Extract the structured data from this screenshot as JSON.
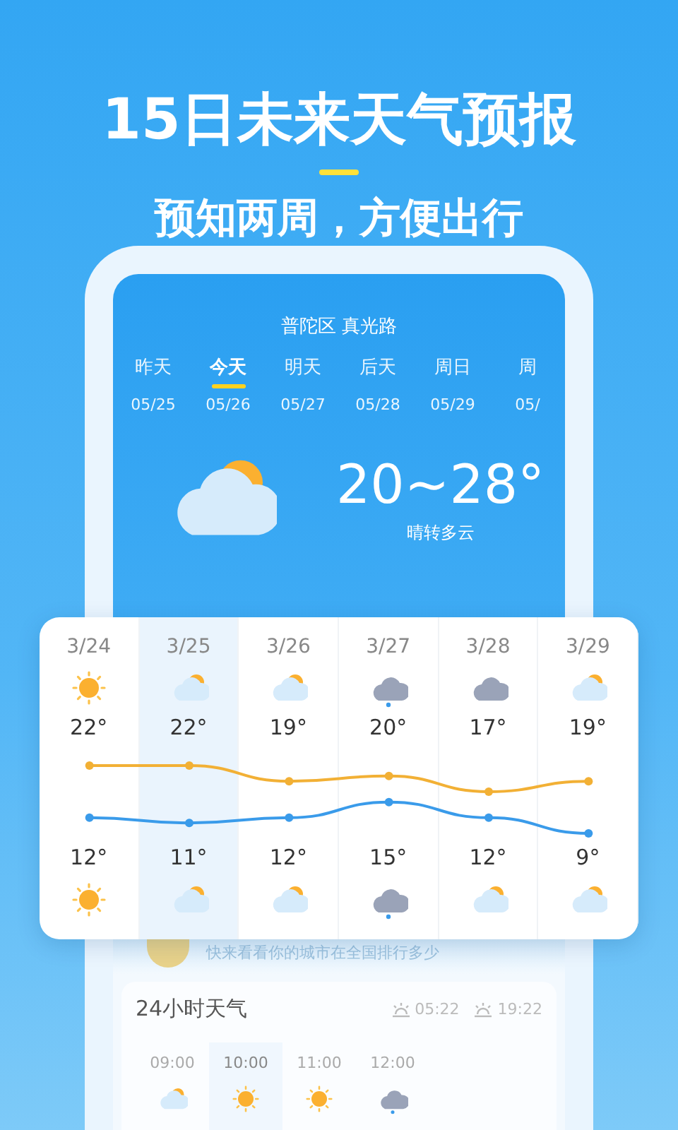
{
  "headline": "15日未来天气预报",
  "subheadline": "预知两周，方便出行",
  "phone": {
    "location": "普陀区 真光路",
    "day_tabs": [
      {
        "label": "昨天",
        "date": "05/25",
        "selected": false
      },
      {
        "label": "今天",
        "date": "05/26",
        "selected": true
      },
      {
        "label": "明天",
        "date": "05/27",
        "selected": false
      },
      {
        "label": "后天",
        "date": "05/28",
        "selected": false
      },
      {
        "label": "周日",
        "date": "05/29",
        "selected": false
      },
      {
        "label": "周",
        "date": "05/",
        "selected": false
      }
    ],
    "current": {
      "temperature": "20~28°",
      "condition": "晴转多云",
      "kind": "partly"
    },
    "ranking_text": "快来看看你的城市在全国排行多少",
    "hourly": {
      "title": "24小时天气",
      "sunrise": "05:22",
      "sunset": "19:22",
      "hours": [
        {
          "time": "09:00",
          "kind": "partly",
          "selected": false
        },
        {
          "time": "10:00",
          "kind": "sunny",
          "selected": true
        },
        {
          "time": "11:00",
          "kind": "sunny",
          "selected": false
        },
        {
          "time": "12:00",
          "kind": "rain",
          "selected": false
        }
      ]
    }
  },
  "forecast": {
    "days": [
      {
        "date": "3/24",
        "high": "22°",
        "low": "12°",
        "day_weather": {
          "kind": "sunny"
        },
        "night_weather": {
          "kind": "sunny"
        },
        "selected": false
      },
      {
        "date": "3/25",
        "high": "22°",
        "low": "11°",
        "day_weather": {
          "kind": "partly"
        },
        "night_weather": {
          "kind": "partly"
        },
        "selected": true
      },
      {
        "date": "3/26",
        "high": "19°",
        "low": "12°",
        "day_weather": {
          "kind": "partly"
        },
        "night_weather": {
          "kind": "partly"
        },
        "selected": false
      },
      {
        "date": "3/27",
        "high": "20°",
        "low": "15°",
        "day_weather": {
          "kind": "rain"
        },
        "night_weather": {
          "kind": "rain"
        },
        "selected": false
      },
      {
        "date": "3/28",
        "high": "17°",
        "low": "12°",
        "day_weather": {
          "kind": "overcast"
        },
        "night_weather": {
          "kind": "partly"
        },
        "selected": false
      },
      {
        "date": "3/29",
        "high": "19°",
        "low": "9°",
        "day_weather": {
          "kind": "partly"
        },
        "night_weather": {
          "kind": "partly"
        },
        "selected": false
      }
    ]
  }
}
